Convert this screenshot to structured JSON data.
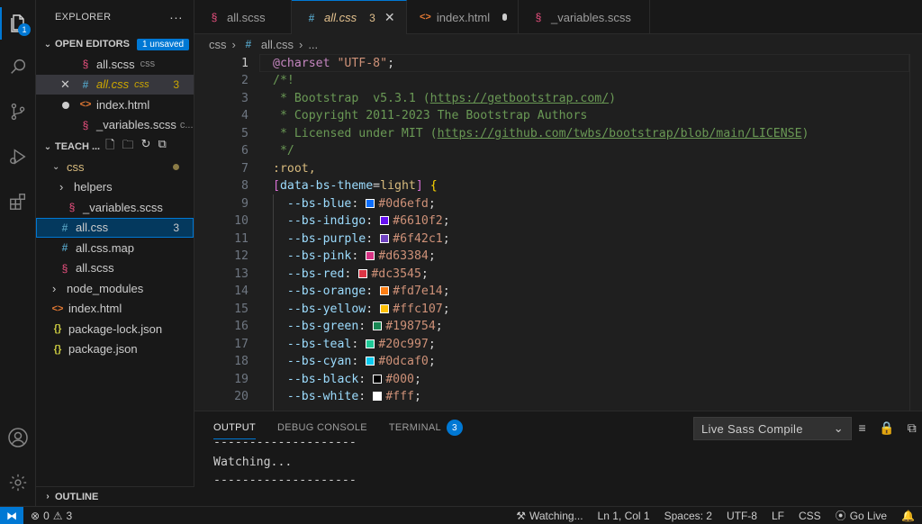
{
  "activity_bar": {
    "explorer_badge": "1",
    "icons": [
      "files-icon",
      "search-icon",
      "source-control-icon",
      "run-debug-icon",
      "extensions-icon",
      "account-icon",
      "settings-gear-icon"
    ]
  },
  "sidebar": {
    "title": "EXPLORER",
    "more": "···",
    "open_editors": {
      "label": "OPEN EDITORS",
      "badge": "1 unsaved",
      "items": [
        {
          "name": "all.scss",
          "folder": "css"
        },
        {
          "name": "all.css",
          "folder": "css",
          "problems": "3"
        },
        {
          "name": "index.html",
          "folder": ""
        },
        {
          "name": "_variables.scss",
          "folder": "c..."
        }
      ]
    },
    "workspace": {
      "label": "TEACH ...",
      "tree": {
        "css": "css",
        "helpers": "helpers",
        "variables": "_variables.scss",
        "all_css": "all.css",
        "all_css_problems": "3",
        "all_css_map": "all.css.map",
        "all_scss": "all.scss",
        "node_modules": "node_modules",
        "index": "index.html",
        "package_lock": "package-lock.json",
        "package": "package.json"
      }
    },
    "outline": "OUTLINE"
  },
  "tabs": [
    {
      "label": "all.scss"
    },
    {
      "label": "all.css",
      "problems": "3"
    },
    {
      "label": "index.html"
    },
    {
      "label": "_variables.scss"
    }
  ],
  "breadcrumb": {
    "folder": "css",
    "file": "all.css",
    "tail": "..."
  },
  "editor": {
    "lines": [
      {
        "n": "1",
        "charset_kw": "@charset",
        "charset_val": "\"UTF-8\"",
        "semi": ";"
      },
      {
        "n": "2",
        "text": "/*!"
      },
      {
        "n": "3",
        "pre": " * Bootstrap  v5.3.1 (",
        "link": "https://getbootstrap.com/",
        "post": ")"
      },
      {
        "n": "4",
        "text": " * Copyright 2011-2023 The Bootstrap Authors"
      },
      {
        "n": "5",
        "pre": " * Licensed under MIT (",
        "link": "https://github.com/twbs/bootstrap/blob/main/LICENSE",
        "post": ")"
      },
      {
        "n": "6",
        "text": " */"
      },
      {
        "n": "7",
        "text": ":root,"
      },
      {
        "n": "8",
        "attr": "data-bs-theme",
        "attr_val": "light"
      },
      {
        "n": "9",
        "prop": "--bs-blue",
        "val": "#0d6efd",
        "color": "#0d6efd"
      },
      {
        "n": "10",
        "prop": "--bs-indigo",
        "val": "#6610f2",
        "color": "#6610f2"
      },
      {
        "n": "11",
        "prop": "--bs-purple",
        "val": "#6f42c1",
        "color": "#6f42c1"
      },
      {
        "n": "12",
        "prop": "--bs-pink",
        "val": "#d63384",
        "color": "#d63384"
      },
      {
        "n": "13",
        "prop": "--bs-red",
        "val": "#dc3545",
        "color": "#dc3545"
      },
      {
        "n": "14",
        "prop": "--bs-orange",
        "val": "#fd7e14",
        "color": "#fd7e14"
      },
      {
        "n": "15",
        "prop": "--bs-yellow",
        "val": "#ffc107",
        "color": "#ffc107"
      },
      {
        "n": "16",
        "prop": "--bs-green",
        "val": "#198754",
        "color": "#198754"
      },
      {
        "n": "17",
        "prop": "--bs-teal",
        "val": "#20c997",
        "color": "#20c997"
      },
      {
        "n": "18",
        "prop": "--bs-cyan",
        "val": "#0dcaf0",
        "color": "#0dcaf0"
      },
      {
        "n": "19",
        "prop": "--bs-black",
        "val": "#000",
        "color": "#000000"
      },
      {
        "n": "20",
        "prop": "--bs-white",
        "val": "#fff",
        "color": "#ffffff"
      }
    ]
  },
  "panel": {
    "tabs": [
      "OUTPUT",
      "DEBUG CONSOLE",
      "TERMINAL"
    ],
    "terminal_badge": "3",
    "channel": "Live Sass Compile",
    "output": [
      "--------------------",
      "Watching...",
      "--------------------"
    ]
  },
  "status": {
    "errors": "0",
    "warnings": "3",
    "watching": "Watching...",
    "position": "Ln 1, Col 1",
    "spaces": "Spaces: 2",
    "encoding": "UTF-8",
    "eol": "LF",
    "language": "CSS",
    "golive": "Go Live"
  }
}
